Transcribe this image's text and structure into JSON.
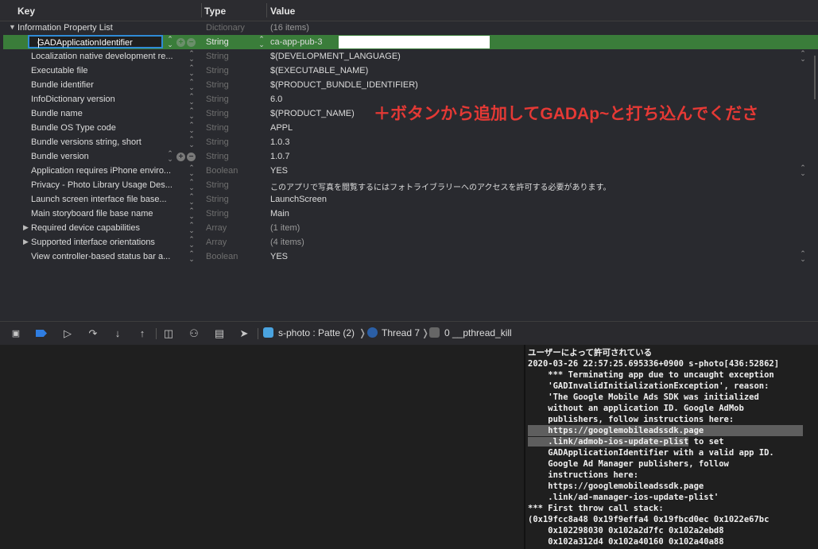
{
  "columns": {
    "key": "Key",
    "type": "Type",
    "value": "Value"
  },
  "plist": {
    "root": {
      "key": "Information Property List",
      "type": "Dictionary",
      "value": "(16 items)"
    },
    "editing": {
      "key": "GADApplicationIdentifier",
      "type": "String",
      "value": "ca-app-pub-3"
    },
    "rows": [
      {
        "key": "Localization native development re...",
        "type": "String",
        "value": "$(DEVELOPMENT_LANGUAGE)"
      },
      {
        "key": "Executable file",
        "type": "String",
        "value": "$(EXECUTABLE_NAME)"
      },
      {
        "key": "Bundle identifier",
        "type": "String",
        "value": "$(PRODUCT_BUNDLE_IDENTIFIER)"
      },
      {
        "key": "InfoDictionary version",
        "type": "String",
        "value": "6.0"
      },
      {
        "key": "Bundle name",
        "type": "String",
        "value": "$(PRODUCT_NAME)"
      },
      {
        "key": "Bundle OS Type code",
        "type": "String",
        "value": "APPL"
      },
      {
        "key": "Bundle versions string, short",
        "type": "String",
        "value": "1.0.3"
      },
      {
        "key": "Bundle version",
        "type": "String",
        "value": "1.0.7"
      },
      {
        "key": "Application requires iPhone enviro...",
        "type": "Boolean",
        "value": "YES"
      },
      {
        "key": "Privacy - Photo Library Usage Des...",
        "type": "String",
        "value": "このアプリで写真を閲覧するにはフォトライブラリーへのアクセスを許可する必要があります。"
      },
      {
        "key": "Launch screen interface file base...",
        "type": "String",
        "value": "LaunchScreen"
      },
      {
        "key": "Main storyboard file base name",
        "type": "String",
        "value": "Main"
      },
      {
        "key": "Required device capabilities",
        "type": "Array",
        "value": "(1 item)"
      },
      {
        "key": "Supported interface orientations",
        "type": "Array",
        "value": "(4 items)"
      },
      {
        "key": "View controller-based status bar a...",
        "type": "Boolean",
        "value": "YES"
      }
    ]
  },
  "annotation": "＋ボタンから追加してGADAp~と打ち込んでくださ",
  "debug_bar": {
    "scheme": "s-photo : Patte (2)",
    "thread": "Thread 7",
    "frame": "0 __pthread_kill"
  },
  "console_lines": [
    "ユーザーによって許可されている",
    "2020-03-26 22:57:25.695336+0900 s-photo[436:52862]",
    "    *** Terminating app due to uncaught exception",
    "    'GADInvalidInitializationException', reason:",
    "    'The Google Mobile Ads SDK was initialized",
    "    without an application ID. Google AdMob",
    "    publishers, follow instructions here:",
    "    https://googlemobileadssdk.page",
    "    .link/admob-ios-update-plist to set",
    "    GADApplicationIdentifier with a valid app ID.",
    "    Google Ad Manager publishers, follow",
    "    instructions here:",
    "    https://googlemobileadssdk.page",
    "    .link/ad-manager-ios-update-plist'",
    "*** First throw call stack:",
    "(0x19fcc8a48 0x19f9effa4 0x19fbcd0ec 0x1022e67bc",
    "    0x102298030 0x102a2d7fc 0x102a2ebd8",
    "    0x102a312d4 0x102a40160 0x102a40a88"
  ],
  "colors": {
    "selection": "#3a7d3a",
    "edit_border": "#2f8bd6",
    "annotation": "#e53935"
  }
}
